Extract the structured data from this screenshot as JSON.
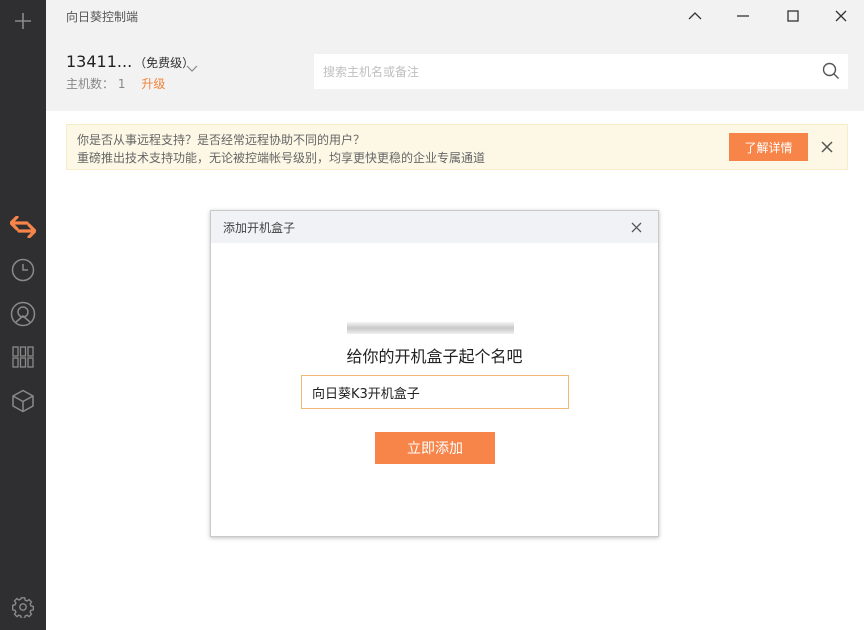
{
  "app": {
    "title": "向日葵控制端"
  },
  "account": {
    "id": "13411...",
    "level": "（免费级）",
    "host_count_label": "主机数：",
    "host_count": "1",
    "upgrade_label": "升级"
  },
  "search": {
    "placeholder": "搜索主机名或备注"
  },
  "notice": {
    "line1": "你是否从事远程支持？是否经常远程协助不同的用户？",
    "line2": "重磅推出技术支持功能，无论被控端帐号级别，均享更快更稳的企业专属通道",
    "button_label": "了解详情"
  },
  "modal": {
    "title": "添加开机盒子",
    "heading": "给你的开机盒子起个名吧",
    "input_value": "向日葵K3开机盒子",
    "submit_label": "立即添加"
  },
  "sidebar": {
    "items": [
      {
        "icon": "plus-icon"
      },
      {
        "icon": "swap-arrows-icon",
        "active": true
      },
      {
        "icon": "clock-icon"
      },
      {
        "icon": "remote-camera-icon"
      },
      {
        "icon": "apps-grid-icon"
      },
      {
        "icon": "cube-icon"
      },
      {
        "icon": "settings-gear-icon"
      }
    ]
  },
  "colors": {
    "accent": "#f7854a",
    "sidebar_bg": "#2f2f31",
    "notice_bg": "#fdf8e6"
  }
}
